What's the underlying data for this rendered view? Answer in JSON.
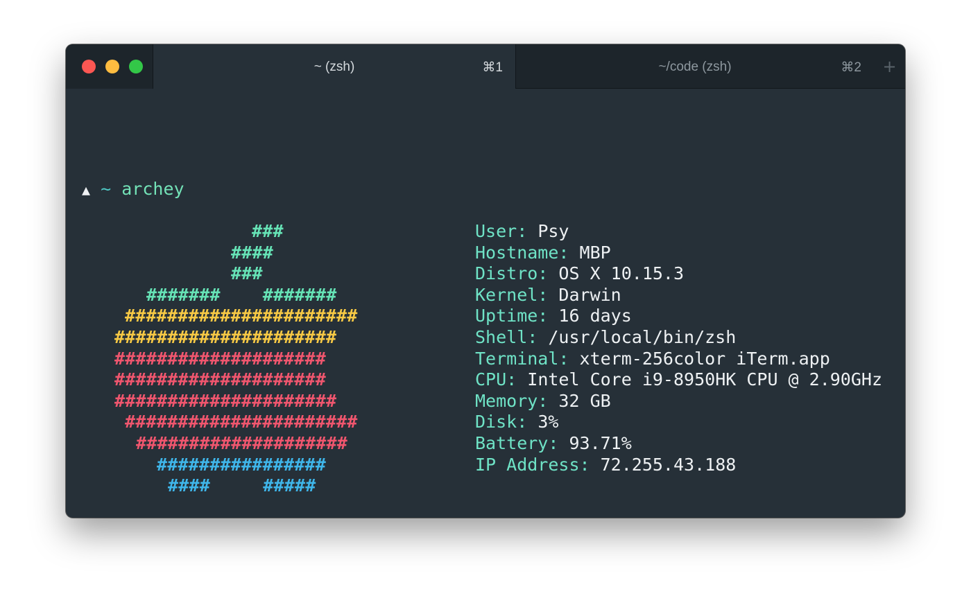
{
  "window": {
    "controls": [
      "close",
      "minimize",
      "zoom"
    ]
  },
  "tabs": [
    {
      "title": "~ (zsh)",
      "shortcut": "⌘1",
      "active": true
    },
    {
      "title": "~/code (zsh)",
      "shortcut": "⌘2",
      "active": false
    }
  ],
  "new_tab_icon": "+",
  "prompt": {
    "arrow": "▲",
    "tilde": "~",
    "command": "archey"
  },
  "logo": {
    "lines": [
      {
        "text": "###",
        "color": "#66e3b6"
      },
      {
        "text": "####",
        "color": "#66e3b6"
      },
      {
        "text": "###",
        "color": "#66e3b6"
      },
      {
        "text": "#######    #######",
        "color": "#66e3b6"
      },
      {
        "text": "######################",
        "color": "#f7c945"
      },
      {
        "text": "#####################",
        "color": "#f7c945"
      },
      {
        "text": "####################",
        "color": "#f0566e"
      },
      {
        "text": "####################",
        "color": "#f0566e"
      },
      {
        "text": "#####################",
        "color": "#f0566e"
      },
      {
        "text": "######################",
        "color": "#f0566e"
      },
      {
        "text": "####################",
        "color": "#f0566e"
      },
      {
        "text": "################",
        "color": "#3fb6ea"
      },
      {
        "text": "####     #####",
        "color": "#3fb6ea"
      }
    ]
  },
  "info": [
    {
      "key": "User:",
      "value": "Psy"
    },
    {
      "key": "Hostname:",
      "value": "MBP"
    },
    {
      "key": "Distro:",
      "value": "OS X 10.15.3"
    },
    {
      "key": "Kernel:",
      "value": "Darwin"
    },
    {
      "key": "Uptime:",
      "value": "16 days"
    },
    {
      "key": "Shell:",
      "value": "/usr/local/bin/zsh"
    },
    {
      "key": "Terminal:",
      "value": "xterm-256color iTerm.app"
    },
    {
      "key": "CPU:",
      "value": "Intel Core i9-8950HK CPU @ 2.90GHz"
    },
    {
      "key": "Memory:",
      "value": "32 GB"
    },
    {
      "key": "Disk:",
      "value": "3%"
    },
    {
      "key": "Battery:",
      "value": "93.71%"
    },
    {
      "key": "IP Address:",
      "value": "72.255.43.188"
    }
  ]
}
